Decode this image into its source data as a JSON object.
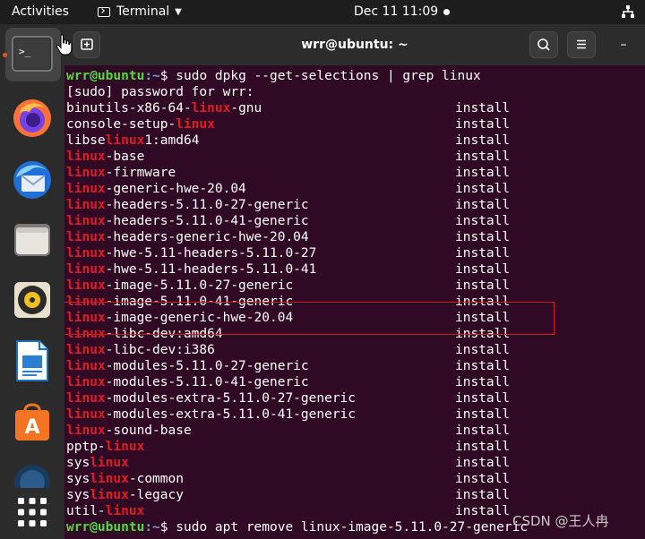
{
  "topbar": {
    "activities": "Activities",
    "app_name": "Terminal",
    "clock": "Dec 11  11:09"
  },
  "dock": {
    "items": [
      "terminal-icon",
      "firefox-icon",
      "thunderbird-icon",
      "files-icon",
      "rhythmbox-icon",
      "libreoffice-writer-icon",
      "software-center-icon",
      "show-apps-icon"
    ]
  },
  "window": {
    "title": "wrr@ubuntu: ~"
  },
  "terminal": {
    "prompt_user": "wrr@ubuntu",
    "prompt_path": ":~",
    "prompt_symbol": "$ ",
    "command1": "sudo dpkg --get-selections | grep linux",
    "sudo_prompt": "[sudo] password for wrr:",
    "packages": [
      {
        "pre": "binutils-x86-64-",
        "hl": "linux",
        "post": "-gnu",
        "status": "install"
      },
      {
        "pre": "console-setup-",
        "hl": "linux",
        "post": "",
        "status": "install"
      },
      {
        "pre": "libse",
        "hl": "linux",
        "post": "1:amd64",
        "status": "install"
      },
      {
        "pre": "",
        "hl": "linux",
        "post": "-base",
        "status": "install"
      },
      {
        "pre": "",
        "hl": "linux",
        "post": "-firmware",
        "status": "install"
      },
      {
        "pre": "",
        "hl": "linux",
        "post": "-generic-hwe-20.04",
        "status": "install"
      },
      {
        "pre": "",
        "hl": "linux",
        "post": "-headers-5.11.0-27-generic",
        "status": "install"
      },
      {
        "pre": "",
        "hl": "linux",
        "post": "-headers-5.11.0-41-generic",
        "status": "install"
      },
      {
        "pre": "",
        "hl": "linux",
        "post": "-headers-generic-hwe-20.04",
        "status": "install"
      },
      {
        "pre": "",
        "hl": "linux",
        "post": "-hwe-5.11-headers-5.11.0-27",
        "status": "install"
      },
      {
        "pre": "",
        "hl": "linux",
        "post": "-hwe-5.11-headers-5.11.0-41",
        "status": "install"
      },
      {
        "pre": "",
        "hl": "linux",
        "post": "-image-5.11.0-27-generic",
        "status": "install"
      },
      {
        "pre": "",
        "hl": "linux",
        "post": "-image-5.11.0-41-generic",
        "status": "install"
      },
      {
        "pre": "",
        "hl": "linux",
        "post": "-image-generic-hwe-20.04",
        "status": "install"
      },
      {
        "pre": "",
        "hl": "linux",
        "post": "-libc-dev:amd64",
        "status": "install"
      },
      {
        "pre": "",
        "hl": "linux",
        "post": "-libc-dev:i386",
        "status": "install"
      },
      {
        "pre": "",
        "hl": "linux",
        "post": "-modules-5.11.0-27-generic",
        "status": "install"
      },
      {
        "pre": "",
        "hl": "linux",
        "post": "-modules-5.11.0-41-generic",
        "status": "install"
      },
      {
        "pre": "",
        "hl": "linux",
        "post": "-modules-extra-5.11.0-27-generic",
        "status": "install"
      },
      {
        "pre": "",
        "hl": "linux",
        "post": "-modules-extra-5.11.0-41-generic",
        "status": "install"
      },
      {
        "pre": "",
        "hl": "linux",
        "post": "-sound-base",
        "status": "install"
      },
      {
        "pre": "pptp-",
        "hl": "linux",
        "post": "",
        "status": "install"
      },
      {
        "pre": "sys",
        "hl": "linux",
        "post": "",
        "status": "install"
      },
      {
        "pre": "sys",
        "hl": "linux",
        "post": "-common",
        "status": "install"
      },
      {
        "pre": "sys",
        "hl": "linux",
        "post": "-legacy",
        "status": "install"
      },
      {
        "pre": "util-",
        "hl": "linux",
        "post": "",
        "status": "install"
      }
    ],
    "command2": "sudo apt remove linux-image-5.11.0-27-generic"
  },
  "watermark": "CSDN @王人冉",
  "colors": {
    "terminal_bg": "#300a24",
    "highlight": "#e01b24",
    "prompt_user": "#4fde3c",
    "prompt_path": "#729fcf",
    "accent": "#e95420"
  }
}
